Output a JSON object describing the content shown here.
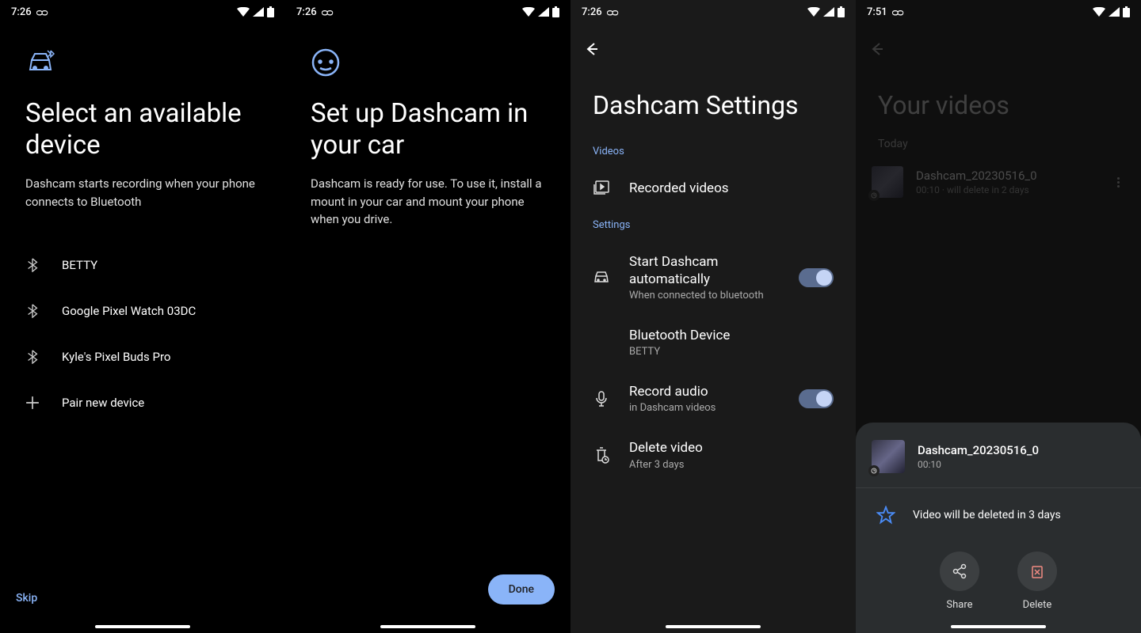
{
  "status": {
    "time_a": "7:26",
    "time_b": "7:51",
    "voicemail": "ᯤ"
  },
  "screen1": {
    "title": "Select an available device",
    "subtitle": "Dashcam starts recording when your phone connects to Bluetooth",
    "devices": [
      {
        "name": "BETTY"
      },
      {
        "name": "Google Pixel Watch 03DC"
      },
      {
        "name": "Kyle's Pixel Buds Pro"
      }
    ],
    "pair_new": "Pair new device",
    "skip": "Skip"
  },
  "screen2": {
    "title": "Set up Dashcam in your car",
    "subtitle": "Dashcam is ready for use. To use it, install a mount in your car and mount your phone when you drive.",
    "done": "Done"
  },
  "screen3": {
    "title": "Dashcam Settings",
    "section_videos": "Videos",
    "recorded_videos": "Recorded videos",
    "section_settings": "Settings",
    "auto_start": {
      "label": "Start Dashcam automatically",
      "sub": "When connected to bluetooth"
    },
    "bt_device": {
      "label": "Bluetooth Device",
      "sub": "BETTY"
    },
    "record_audio": {
      "label": "Record audio",
      "sub": "in Dashcam videos"
    },
    "delete_video": {
      "label": "Delete video",
      "sub": "After 3 days"
    }
  },
  "screen4": {
    "title": "Your videos",
    "today": "Today",
    "video": {
      "name": "Dashcam_20230516_0",
      "meta": "00:10 · will delete in 2 days"
    },
    "sheet": {
      "name": "Dashcam_20230516_0",
      "duration": "00:10",
      "notice": "Video will be deleted in 3 days",
      "share": "Share",
      "delete": "Delete"
    }
  }
}
